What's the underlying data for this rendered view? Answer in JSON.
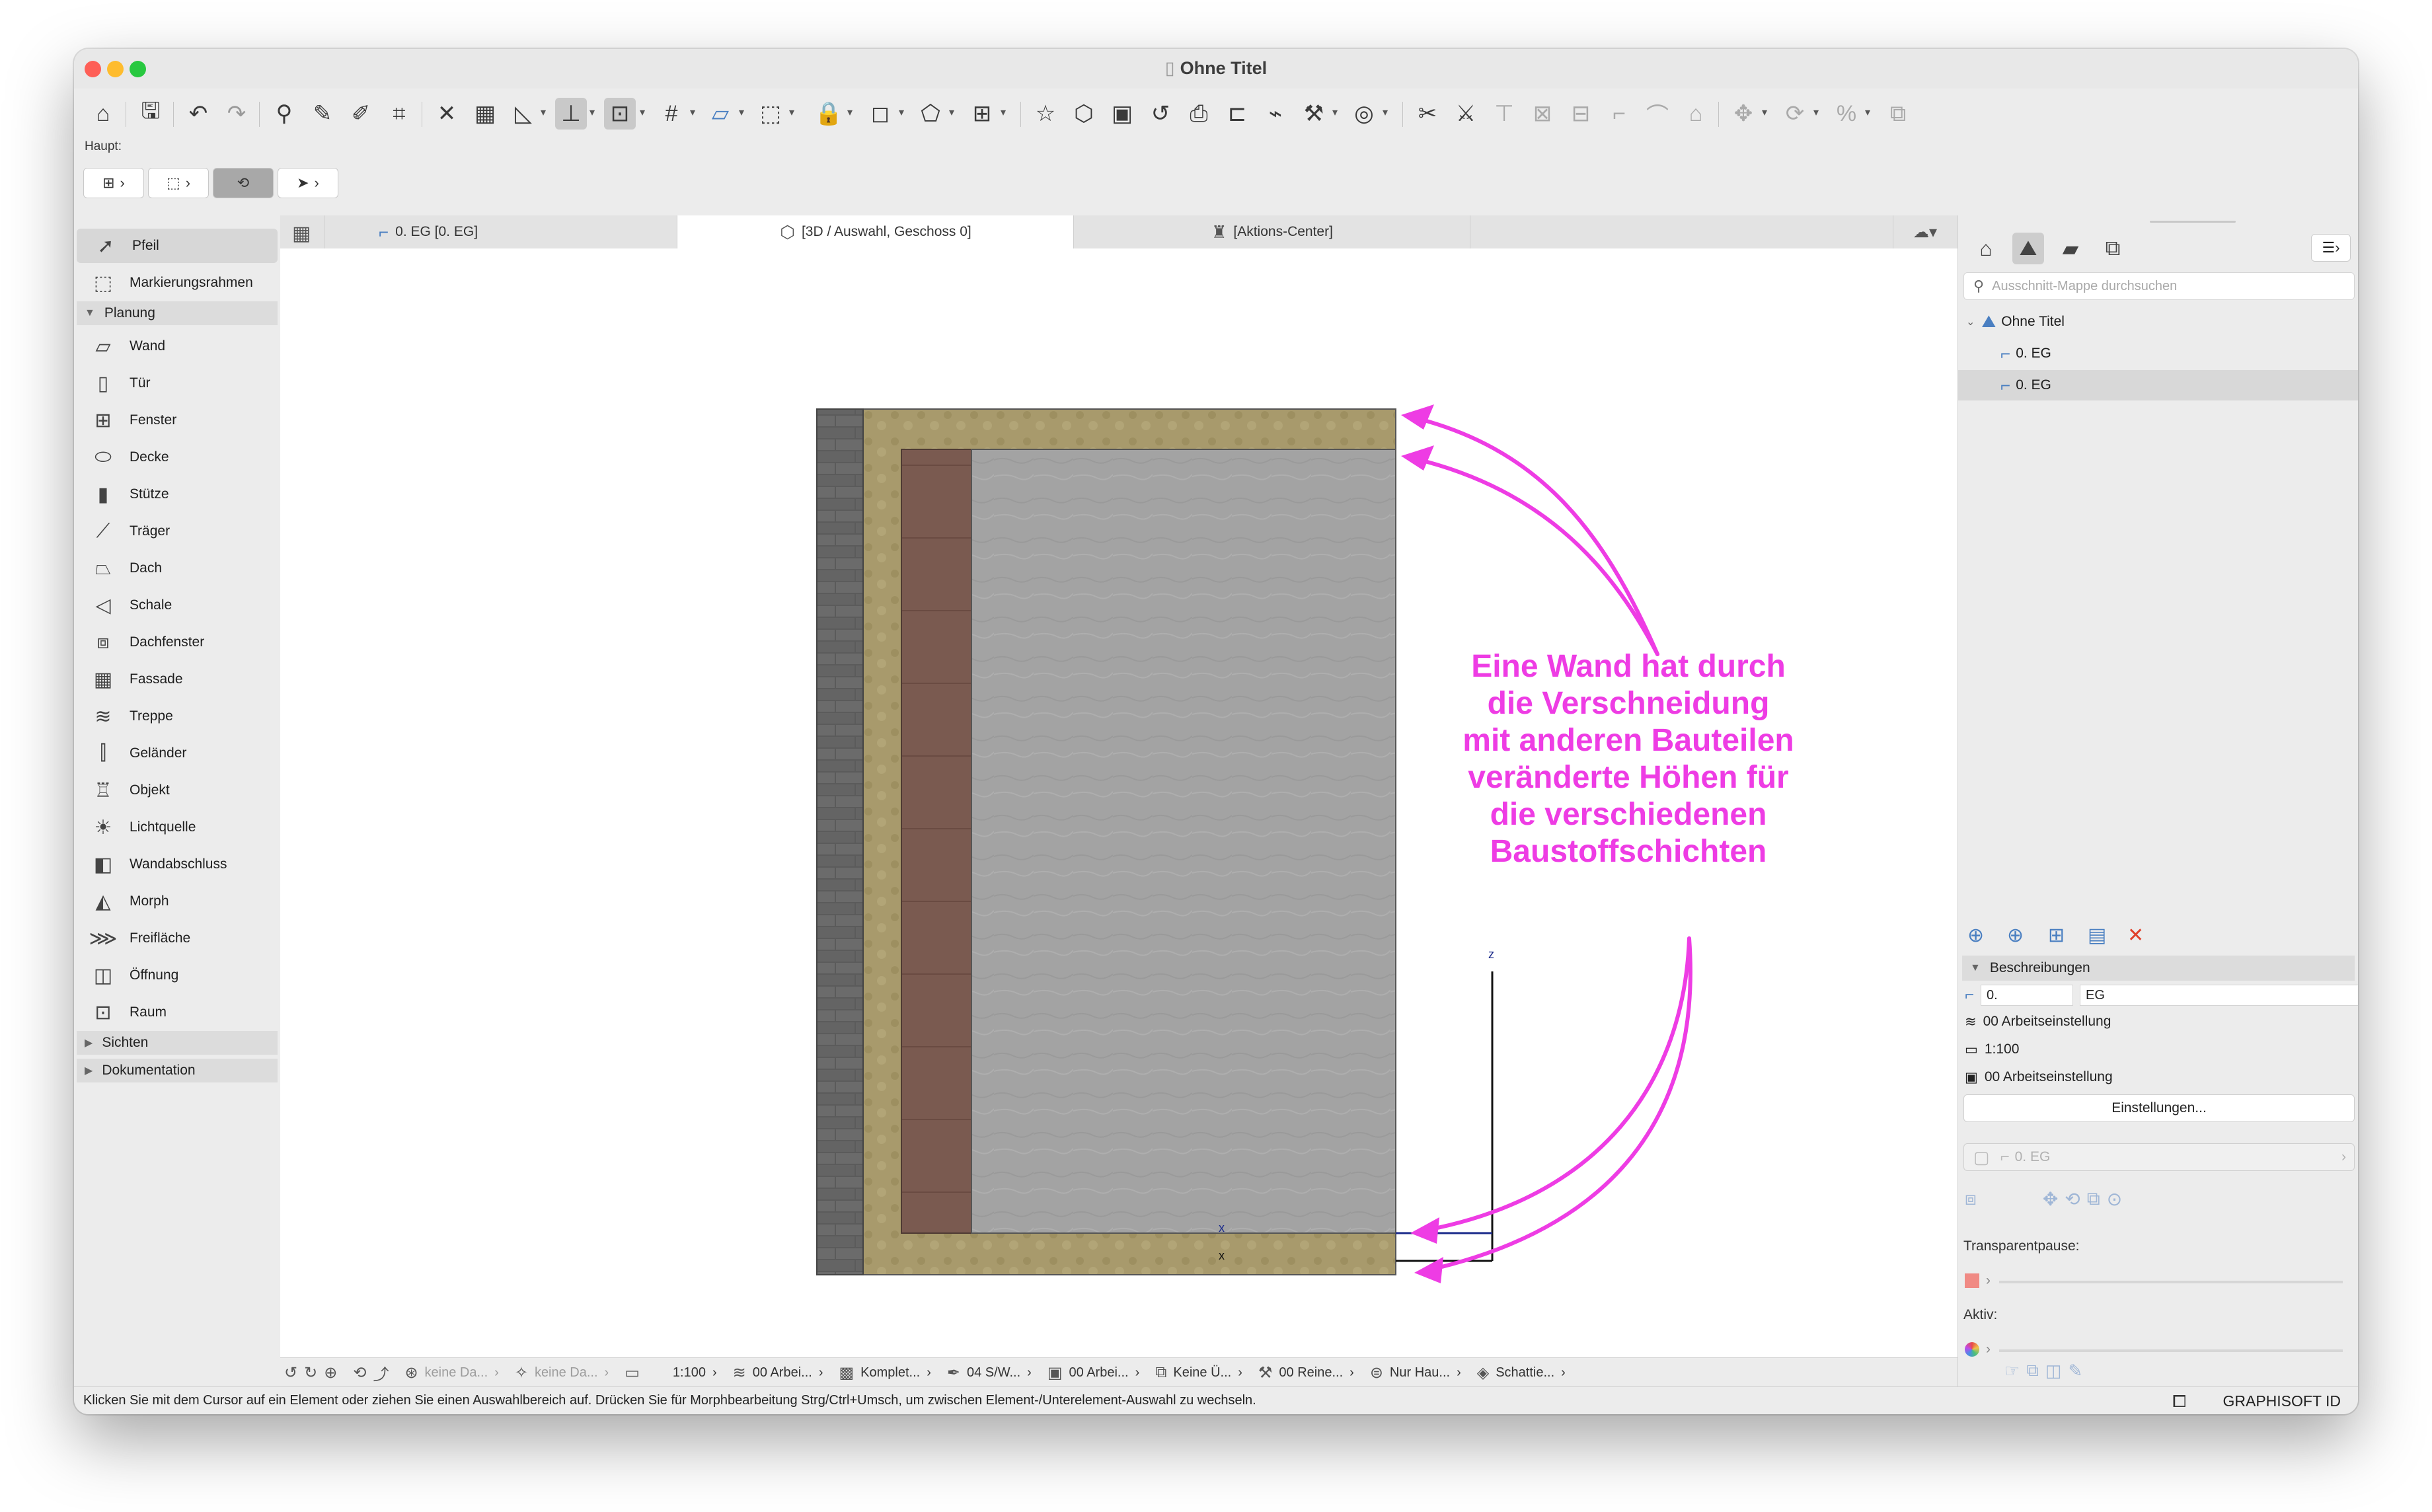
{
  "window": {
    "title": "Ohne Titel"
  },
  "toolbar": {
    "haupt_label": "Haupt:"
  },
  "left_panel": {
    "tools_top": [
      {
        "label": "Pfeil",
        "icon": "arrow-cursor-icon",
        "selected": true
      },
      {
        "label": "Markierungsrahmen",
        "icon": "marquee-icon",
        "selected": false
      }
    ],
    "category_planung": "Planung",
    "tools_planung": [
      {
        "label": "Wand",
        "icon": "wall-icon"
      },
      {
        "label": "Tür",
        "icon": "door-icon"
      },
      {
        "label": "Fenster",
        "icon": "window-icon"
      },
      {
        "label": "Decke",
        "icon": "slab-icon"
      },
      {
        "label": "Stütze",
        "icon": "column-icon"
      },
      {
        "label": "Träger",
        "icon": "beam-icon"
      },
      {
        "label": "Dach",
        "icon": "roof-icon"
      },
      {
        "label": "Schale",
        "icon": "shell-icon"
      },
      {
        "label": "Dachfenster",
        "icon": "skylight-icon"
      },
      {
        "label": "Fassade",
        "icon": "curtain-wall-icon"
      },
      {
        "label": "Treppe",
        "icon": "stair-icon"
      },
      {
        "label": "Geländer",
        "icon": "railing-icon"
      },
      {
        "label": "Objekt",
        "icon": "object-icon"
      },
      {
        "label": "Lichtquelle",
        "icon": "lamp-icon"
      },
      {
        "label": "Wandabschluss",
        "icon": "wall-end-icon"
      },
      {
        "label": "Morph",
        "icon": "morph-icon"
      },
      {
        "label": "Freifläche",
        "icon": "mesh-icon"
      },
      {
        "label": "Öffnung",
        "icon": "opening-icon"
      },
      {
        "label": "Raum",
        "icon": "zone-icon"
      }
    ],
    "category_sichten": "Sichten",
    "category_dokumentation": "Dokumentation"
  },
  "tabs": [
    {
      "label": "0. EG [0. EG]",
      "icon": "floor-plan-icon",
      "active": false
    },
    {
      "label": "[3D / Auswahl, Geschoss 0]",
      "icon": "cube-3d-icon",
      "active": true
    },
    {
      "label": "[Aktions-Center]",
      "icon": "action-center-icon",
      "active": false
    }
  ],
  "canvas": {
    "annotation": "Eine Wand hat durch die Verschneidung mit anderen Bauteilen veränderte Höhen für die verschiedenen Baustoffschichten",
    "annotation_lines": [
      "Eine Wand hat durch",
      "die Verschneidung",
      "mit anderen Bauteilen",
      "veränderte Höhen für",
      "die verschiedenen",
      "Baustoffschichten"
    ],
    "axis_z": "z",
    "axis_x": "x",
    "accent_color": "#ee3ce4"
  },
  "bottom_bar": {
    "layer_combo_1": "keine Da...",
    "layer_combo_2": "keine Da...",
    "scale": "1:100",
    "layer": "00 Arbei...",
    "model": "Komplet...",
    "pen": "04 S/W...",
    "display": "00 Arbei...",
    "override": "Keine Ü...",
    "renovation": "00 Reine...",
    "structure": "Nur Hau...",
    "shadow": "Schattie..."
  },
  "status": {
    "message": "Klicken Sie mit dem Cursor auf ein Element oder ziehen Sie einen Auswahlbereich auf. Drücken Sie für Morphbearbeitung Strg/Ctrl+Umsch, um zwischen Element-/Unterelement-Auswahl zu wechseln.",
    "brand": "GRAPHISOFT ID"
  },
  "right_panel": {
    "search_placeholder": "Ausschnitt-Mappe durchsuchen",
    "tree": [
      {
        "label": "Ohne Titel",
        "level": 0,
        "selected": false
      },
      {
        "label": "0. EG",
        "level": 1,
        "selected": false
      },
      {
        "label": "0. EG",
        "level": 1,
        "selected": true
      }
    ],
    "section_beschreibungen": "Beschreibungen",
    "id_field": "0.",
    "name_field": "EG",
    "layer_combo": "00 Arbeitseinstellung",
    "scale": "1:100",
    "model_view": "00 Arbeitseinstellung",
    "settings_button": "Einstellungen...",
    "view_field": "0. EG",
    "transparent_label": "Transparentpause:",
    "active_label": "Aktiv:"
  }
}
